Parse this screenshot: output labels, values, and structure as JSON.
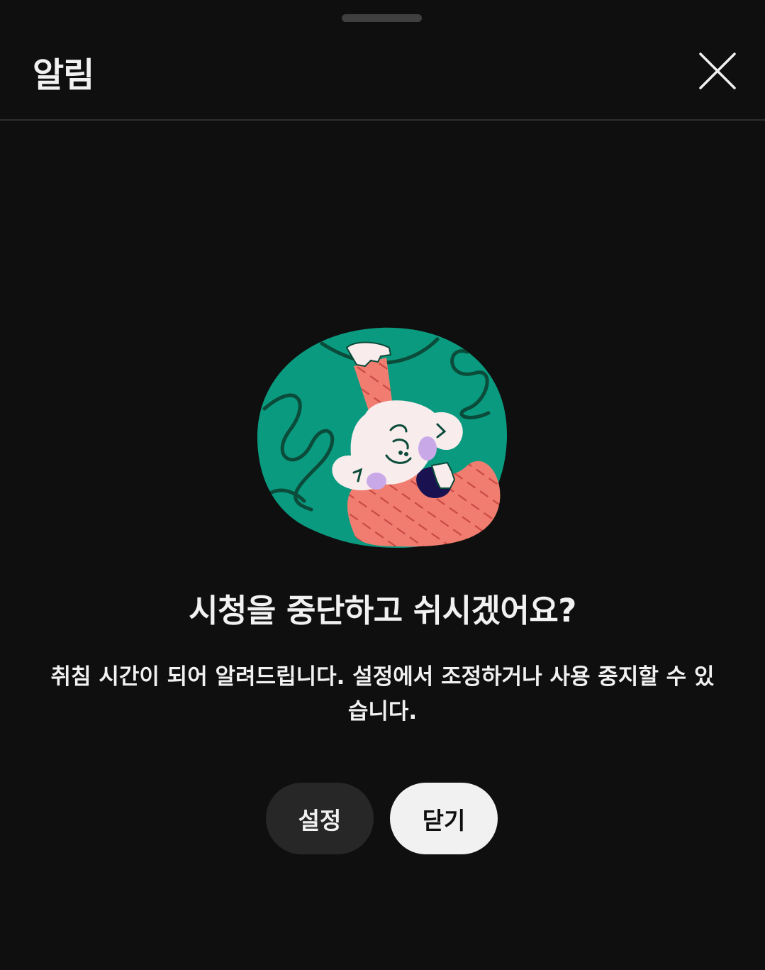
{
  "header": {
    "title": "알림",
    "close_icon": "close-icon"
  },
  "illustration": {
    "name": "sleeping-character-illustration",
    "colors": {
      "background": "#0a9a7f",
      "lines": "#0b4b3a",
      "body": "#f07d6f",
      "face": "#f8ecec",
      "cheek": "#c9a8e8",
      "dark": "#1a1150"
    }
  },
  "dialog": {
    "headline": "시청을 중단하고 쉬시겠어요?",
    "description": "취침 시간이 되어 알려드립니다. 설정에서 조정하거나 사용 중지할 수 있습니다."
  },
  "buttons": {
    "settings_label": "설정",
    "close_label": "닫기"
  },
  "theme": {
    "background": "#0f0f0f",
    "text": "#f1f1f1",
    "secondary_button": "#272727",
    "primary_button": "#f1f1f1"
  }
}
